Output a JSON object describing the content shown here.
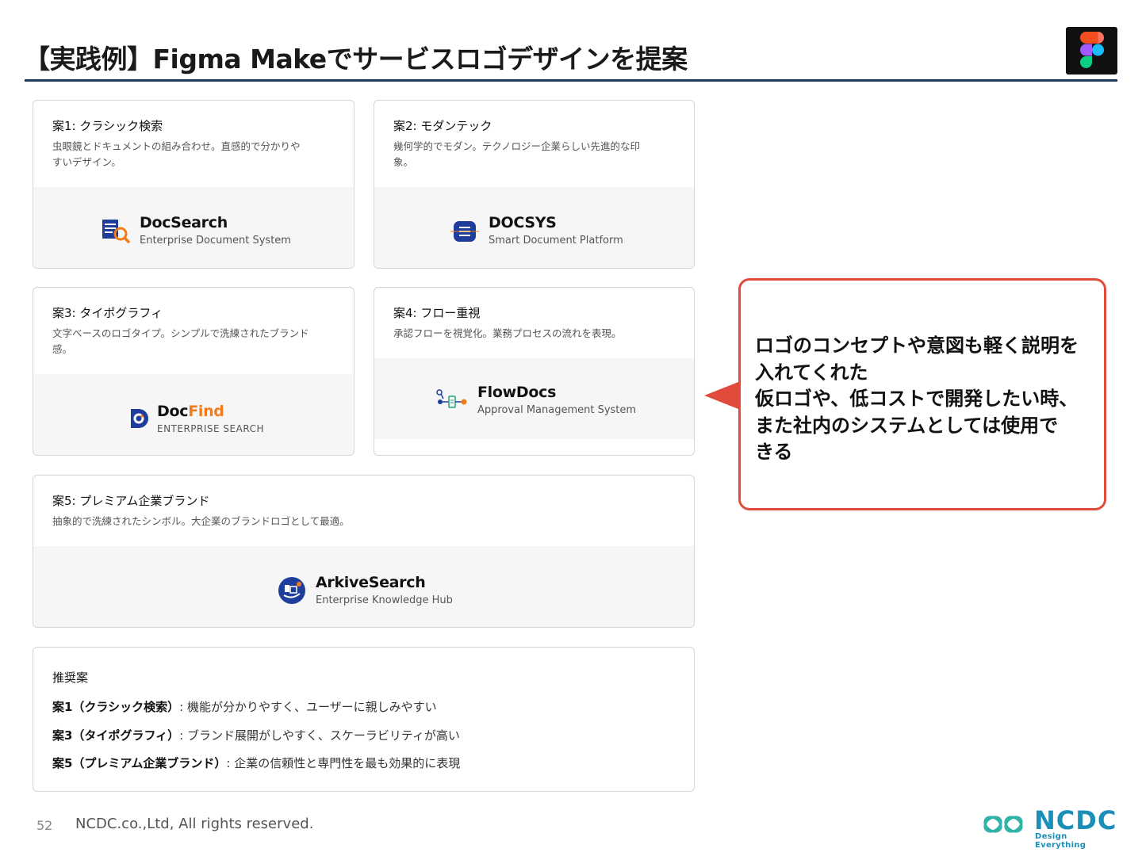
{
  "header": {
    "title": "【実践例】Figma Makeでサービスロゴデザインを提案"
  },
  "proposals": [
    {
      "title": "案1: クラシック検索",
      "desc_line1": "虫眼鏡とドキュメントの組み合わせ。直感的で分かりや",
      "desc_line2": "すいデザイン。",
      "logo_name": "DocSearch",
      "logo_sub": "Enterprise Document System",
      "mark_icon": "document-magnifier-icon"
    },
    {
      "title": "案2: モダンテック",
      "desc_line1": "幾何学的でモダン。テクノロジー企業らしい先進的な印",
      "desc_line2": "象。",
      "logo_name": "DOCSYS",
      "logo_sub": "Smart Document Platform",
      "mark_icon": "rounded-square-document-icon"
    },
    {
      "title": "案3: タイポグラフィ",
      "desc_line1": "文字ベースのロゴタイプ。シンプルで洗練されたブランド",
      "desc_line2": "感。",
      "logo_name_a": "Doc",
      "logo_name_b": "Find",
      "logo_sub": "ENTERPRISE SEARCH",
      "mark_icon": "d-target-icon"
    },
    {
      "title": "案4: フロー重視",
      "desc_line1": "承認フローを視覚化。業務プロセスの流れを表現。",
      "logo_name": "FlowDocs",
      "logo_sub": "Approval Management System",
      "mark_icon": "flow-nodes-icon"
    },
    {
      "title": "案5: プレミアム企業ブランド",
      "desc_line1": "抽象的で洗練されたシンボル。大企業のブランドロゴとして最適。",
      "logo_name": "ArkiveSearch",
      "logo_sub": "Enterprise Knowledge Hub",
      "mark_icon": "circle-emblem-icon"
    }
  ],
  "recommendation": {
    "heading": "推奨案",
    "items": [
      {
        "label": "案1（クラシック検索）",
        "text": ": 機能が分かりやすく、ユーザーに親しみやすい"
      },
      {
        "label": "案3（タイポグラフィ）",
        "text": ": ブランド展開がしやすく、スケーラビリティが高い"
      },
      {
        "label": "案5（プレミアム企業ブランド）",
        "text": ": 企業の信頼性と専門性を最も効果的に表現"
      }
    ]
  },
  "callout": {
    "line1": "ロゴのコンセプトや意図も軽く説明を",
    "line2": "入れてくれた",
    "line3": "仮ロゴや、低コストで開発したい時、",
    "line4": "また社内のシステムとしては使用で",
    "line5": "きる"
  },
  "footer": {
    "page_number": "52",
    "copyright": "NCDC.co.,Ltd, All rights reserved.",
    "brand": "NCDC",
    "tagline": "Design Everything"
  },
  "colors": {
    "title_rule": "#1d3a5c",
    "callout_border": "#e14b3b",
    "docfind_accent": "#f07c1a",
    "brand_blue": "#1c8fb8",
    "logo_navy": "#1f3e9c"
  }
}
